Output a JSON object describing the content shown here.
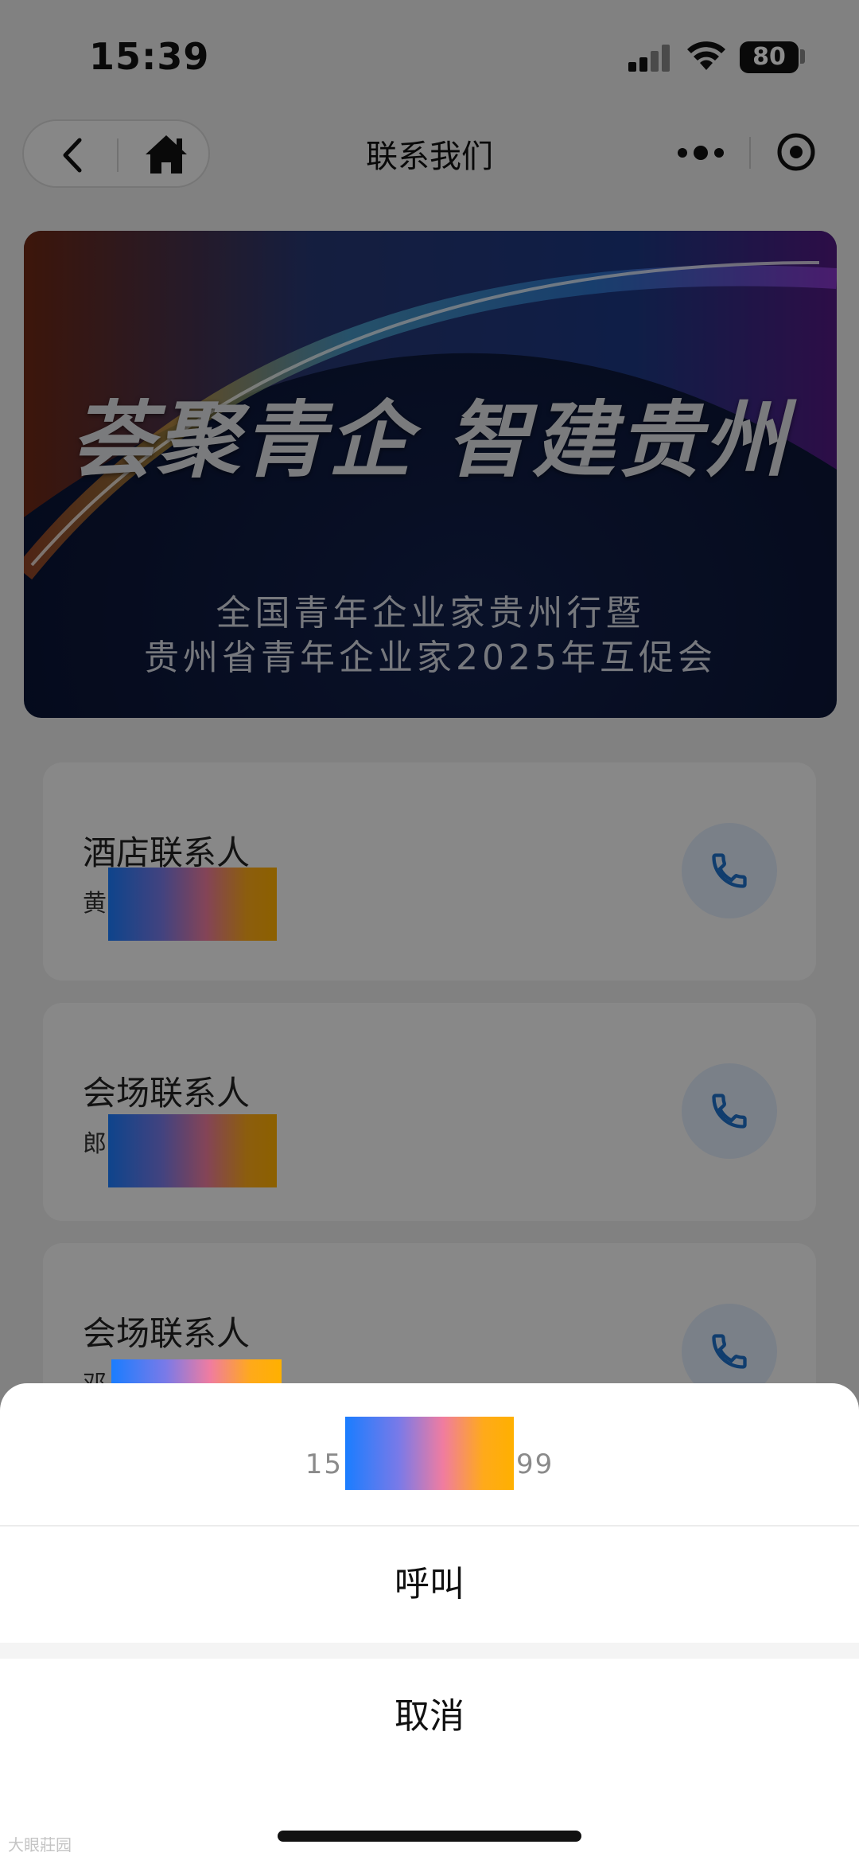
{
  "status_bar": {
    "time": "15:39",
    "battery": "80"
  },
  "nav": {
    "title": "联系我们"
  },
  "banner": {
    "headline": "荟聚青企 智建贵州",
    "subtitle_line1": "全国青年企业家贵州行暨",
    "subtitle_line2": "贵州省青年企业家2025年互促会"
  },
  "contacts": [
    {
      "role": "酒店联系人",
      "name_visible": "黄"
    },
    {
      "role": "会场联系人",
      "name_visible": "郎"
    },
    {
      "role": "会场联系人",
      "name_visible": "邓"
    }
  ],
  "action_sheet": {
    "phone_prefix": "15",
    "phone_suffix": "99",
    "call_label": "呼叫",
    "cancel_label": "取消"
  },
  "watermark": "大眼莊园",
  "colors": {
    "accent": "#1e6fc8",
    "call_bg": "#dfe9f7"
  }
}
